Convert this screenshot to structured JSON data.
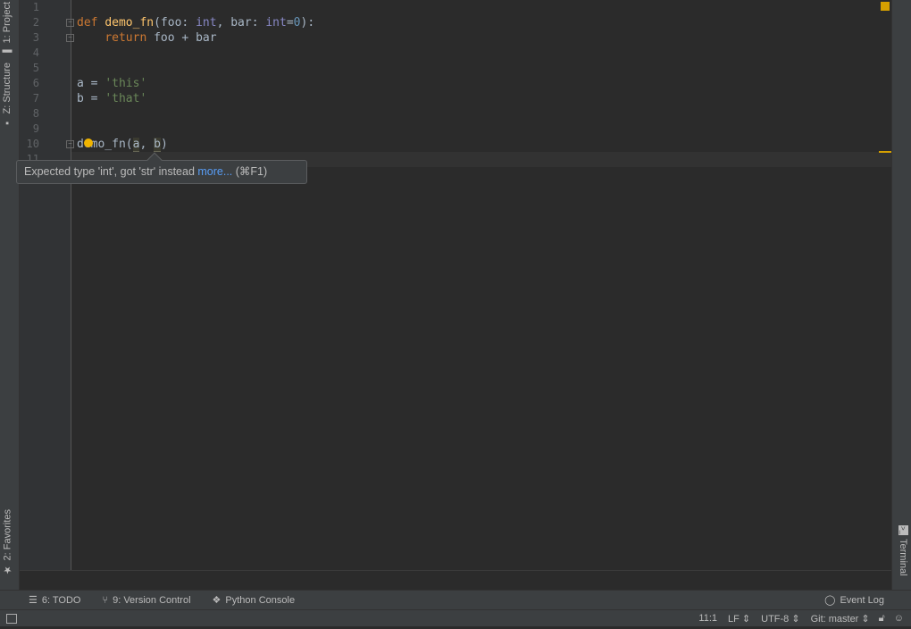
{
  "left_tabs": [
    {
      "label": "1: Project",
      "icon": "folder-icon"
    },
    {
      "label": "Z: Structure",
      "icon": "structure-icon"
    },
    {
      "label": "2: Favorites",
      "icon": "star-icon"
    }
  ],
  "right_tabs": [
    {
      "label": "Terminal",
      "icon": "terminal-icon"
    }
  ],
  "editor": {
    "line_numbers": [
      "1",
      "2",
      "3",
      "4",
      "5",
      "6",
      "7",
      "8",
      "9",
      "10",
      "11"
    ],
    "lines": {
      "l2": {
        "kw": "def",
        "fn": "demo_fn",
        "p1": "(foo: ",
        "t1": "int",
        "p2": ", bar: ",
        "t2": "int",
        "p3": "=",
        "n": "0",
        "p4": "):"
      },
      "l3": {
        "indent": "    ",
        "kw": "return",
        "rest": " foo + bar"
      },
      "l6": {
        "lhs": "a = ",
        "str": "'this'"
      },
      "l7": {
        "lhs": "b = ",
        "str": "'that'"
      },
      "l10": {
        "pre": "demo_fn(",
        "a": "a",
        "mid": ", ",
        "b": "b",
        "post": ")"
      }
    },
    "colors": {
      "keyword": "#cc7832",
      "function": "#ffc66d",
      "type": "#8888c6",
      "number": "#6897bb",
      "string": "#6a8759",
      "warning": "#e0a800"
    }
  },
  "tooltip": {
    "message": "Expected type 'int', got 'str' instead ",
    "link": "more...",
    "shortcut": " (⌘F1)"
  },
  "toolbar": {
    "todo": "6: TODO",
    "vcs": "9: Version Control",
    "console": "Python Console",
    "event_log": "Event Log"
  },
  "status": {
    "position": "11:1",
    "line_sep": "LF ⇕",
    "encoding": "UTF-8 ⇕",
    "git": "Git: master ⇕"
  }
}
